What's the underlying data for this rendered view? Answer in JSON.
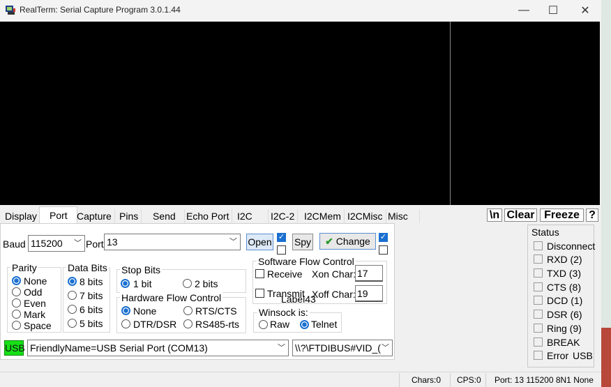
{
  "window": {
    "title": "RealTerm: Serial Capture Program 3.0.1.44",
    "minimize": "—",
    "maximize": "☐",
    "close": "✕"
  },
  "tabs": [
    {
      "label": "Display"
    },
    {
      "label": "Port"
    },
    {
      "label": "Capture"
    },
    {
      "label": "Pins"
    },
    {
      "label": "Send"
    },
    {
      "label": "Echo Port"
    },
    {
      "label": "I2C"
    },
    {
      "label": "I2C-2"
    },
    {
      "label": "I2CMem"
    },
    {
      "label": "I2CMisc"
    },
    {
      "label": "Misc"
    }
  ],
  "active_tab": "Port",
  "toolbar": {
    "newline": "\\n",
    "clear": "Clear",
    "freeze": "Freeze",
    "help": "?"
  },
  "port": {
    "baud_label": "Baud",
    "baud_value": "115200",
    "port_label": "Port",
    "port_value": "13",
    "open_label": "Open",
    "spy_label": "Spy",
    "change_label": "Change",
    "parity": {
      "title": "Parity",
      "options": [
        "None",
        "Odd",
        "Even",
        "Mark",
        "Space"
      ],
      "selected": "None"
    },
    "data_bits": {
      "title": "Data Bits",
      "options": [
        "8 bits",
        "7 bits",
        "6 bits",
        "5 bits"
      ],
      "selected": "8 bits"
    },
    "stop_bits": {
      "title": "Stop Bits",
      "options": [
        "1 bit",
        "2 bits"
      ],
      "selected": "1 bit"
    },
    "hw_flow": {
      "title": "Hardware Flow Control",
      "options": [
        "None",
        "RTS/CTS",
        "DTR/DSR",
        "RS485-rts"
      ],
      "selected": "None"
    },
    "sw_flow": {
      "title": "Software Flow Control",
      "receive": "Receive",
      "transmit": "Transmit",
      "xon_label": "Xon Char:",
      "xon_value": "17",
      "xoff_label": "Xoff Char:",
      "xoff_value": "19"
    },
    "label43": "Label43",
    "winsock": {
      "title": "Winsock is:",
      "options": [
        "Raw",
        "Telnet"
      ],
      "selected": "Telnet"
    },
    "usb_badge": "USB",
    "friendly_name": "FriendlyName=USB Serial Port (COM13)",
    "device_path": "\\\\?\\FTDIBUS#VID_("
  },
  "status": {
    "title": "Status",
    "items": [
      "Disconnect",
      "RXD (2)",
      "TXD (3)",
      "CTS (8)",
      "DCD (1)",
      "DSR (6)",
      "Ring (9)",
      "BREAK",
      "Error"
    ],
    "usb_tag": "USB"
  },
  "statusbar": {
    "chars": "Chars:0",
    "cps": "CPS:0",
    "port_info": "Port: 13  115200 8N1 None"
  },
  "colors": {
    "usb_badge": "#16e016",
    "terminal_bg": "#000000",
    "accent": "#1a6fd0"
  }
}
